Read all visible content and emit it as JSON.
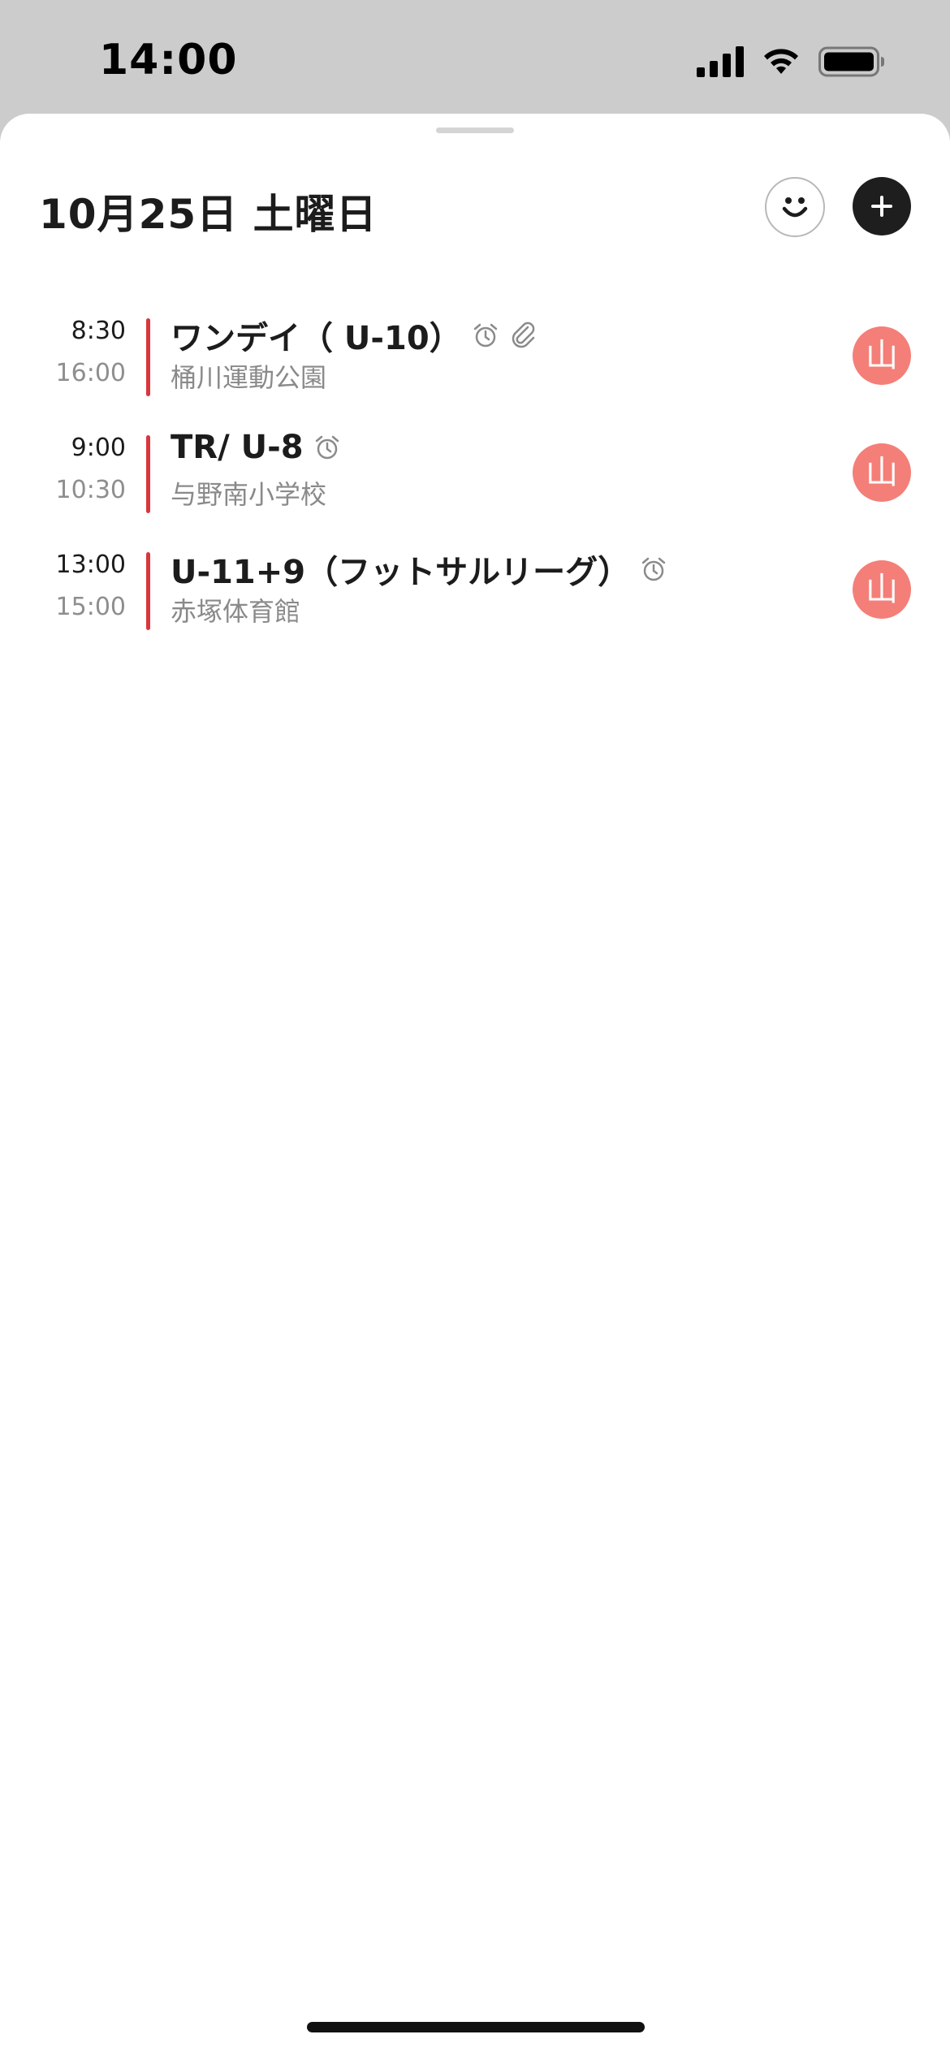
{
  "status_bar": {
    "time": "14:00",
    "icons": [
      "cellular-signal-icon",
      "wifi-icon",
      "battery-icon"
    ]
  },
  "header": {
    "date_title": "10月25日 土曜日",
    "face_button_icon": "smiley-face-icon",
    "add_button_icon": "plus-icon"
  },
  "events": [
    {
      "start": "8:30",
      "end": "16:00",
      "title": "ワンデイ（ U-10）",
      "location": "桶川運動公園",
      "icons": [
        "alarm-icon",
        "paperclip-icon"
      ],
      "avatar": "山"
    },
    {
      "start": "9:00",
      "end": "10:30",
      "title": "TR/ U-8",
      "location": "与野南小学校",
      "icons": [
        "alarm-icon"
      ],
      "avatar": "山"
    },
    {
      "start": "13:00",
      "end": "15:00",
      "title": "U-11+9（フットサルリーグ）",
      "location": "赤塚体育館",
      "icons": [
        "alarm-icon"
      ],
      "avatar": "山"
    }
  ],
  "colors": {
    "event_bar": "#d9363e",
    "avatar_bg": "#f47f78",
    "add_button_bg": "#1e1e1e",
    "secondary_text": "#8a8a8a"
  }
}
